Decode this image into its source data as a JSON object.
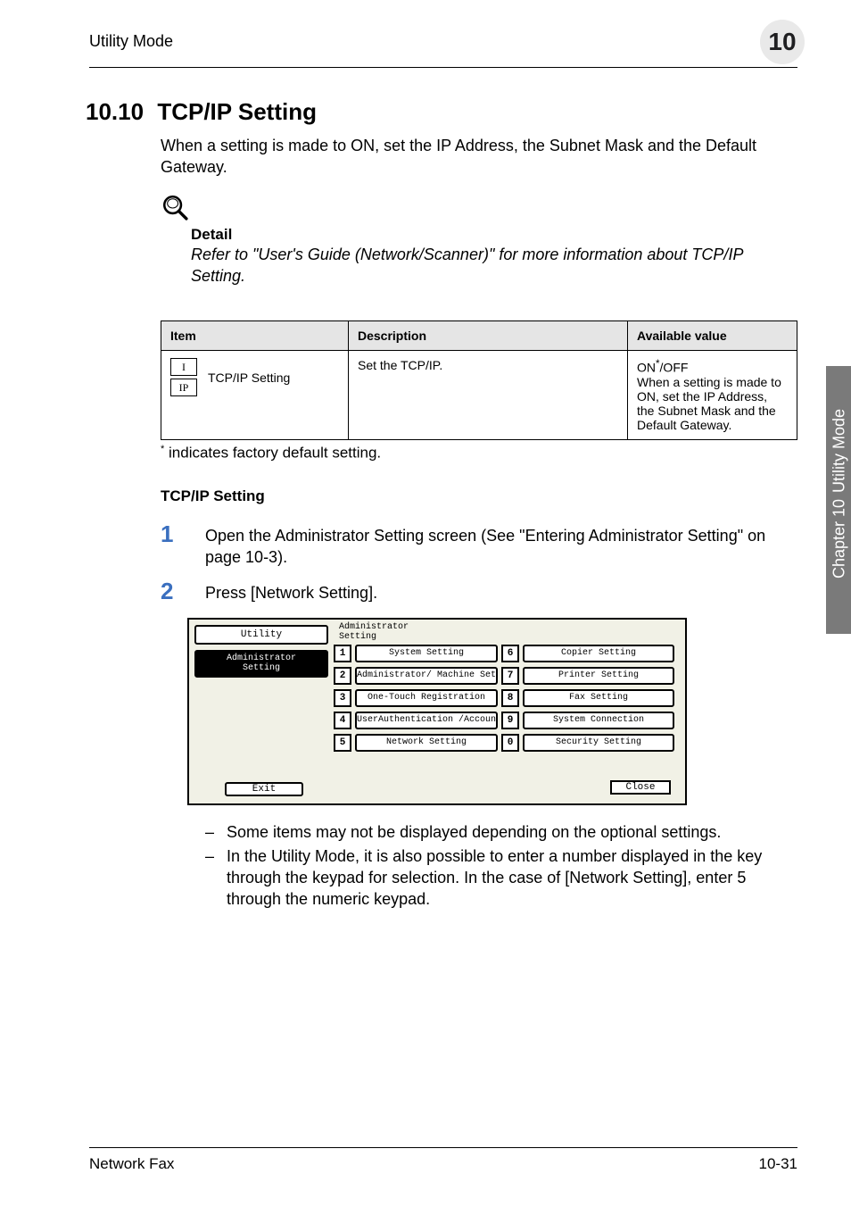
{
  "header": {
    "running_head": "Utility Mode",
    "chapter_number": "10"
  },
  "section": {
    "number": "10.10",
    "title": "TCP/IP Setting",
    "intro": "When a setting is made to ON, set the IP Address, the Subnet Mask and the Default Gateway."
  },
  "detail": {
    "label": "Detail",
    "text": "Refer to \"User's Guide (Network/Scanner)\" for more information about TCP/IP Setting."
  },
  "table": {
    "headers": {
      "item": "Item",
      "description": "Description",
      "available": "Available value"
    },
    "rows": [
      {
        "icon_top": "I",
        "icon_bottom": "IP",
        "name": "TCP/IP Setting",
        "description": "Set the TCP/IP.",
        "available_line1": "ON",
        "available_sup": "*",
        "available_line1b": "/OFF",
        "available_rest": "When a setting is made to ON, set the IP Address, the Subnet Mask and the Default Gateway."
      }
    ]
  },
  "footnote": {
    "mark": "*",
    "text": " indicates factory default setting."
  },
  "subheading": "TCP/IP Setting",
  "steps": [
    {
      "num": "1",
      "text": "Open the Administrator Setting screen (See \"Entering Administrator Setting\" on page 10-3)."
    },
    {
      "num": "2",
      "text": "Press [Network Setting]."
    }
  ],
  "device": {
    "left_box1": "Utility",
    "left_box2_line1": "Administrator",
    "left_box2_line2": "Setting",
    "exit": "Exit",
    "title_line1": "Administrator",
    "title_line2": "Setting",
    "menu": [
      {
        "n": "1",
        "label": "System Setting"
      },
      {
        "n": "2",
        "label": "Administrator/\nMachine Setting"
      },
      {
        "n": "3",
        "label": "One-Touch\nRegistration"
      },
      {
        "n": "4",
        "label": "UserAuthentication\n/Account Track"
      },
      {
        "n": "5",
        "label": "Network Setting"
      },
      {
        "n": "6",
        "label": "Copier Setting"
      },
      {
        "n": "7",
        "label": "Printer Setting"
      },
      {
        "n": "8",
        "label": "Fax Setting"
      },
      {
        "n": "9",
        "label": "System Connection"
      },
      {
        "n": "0",
        "label": "Security Setting"
      }
    ],
    "close": "Close"
  },
  "bullets": [
    "Some items may not be displayed depending on the optional settings.",
    "In the Utility Mode, it is also possible to enter a number displayed in the key through the keypad for selection. In the case of [Network Setting], enter 5 through the numeric keypad."
  ],
  "sidetab": {
    "section": "Utility Mode",
    "chapter": "Chapter 10"
  },
  "footer": {
    "left": "Network Fax",
    "right": "10-31"
  }
}
